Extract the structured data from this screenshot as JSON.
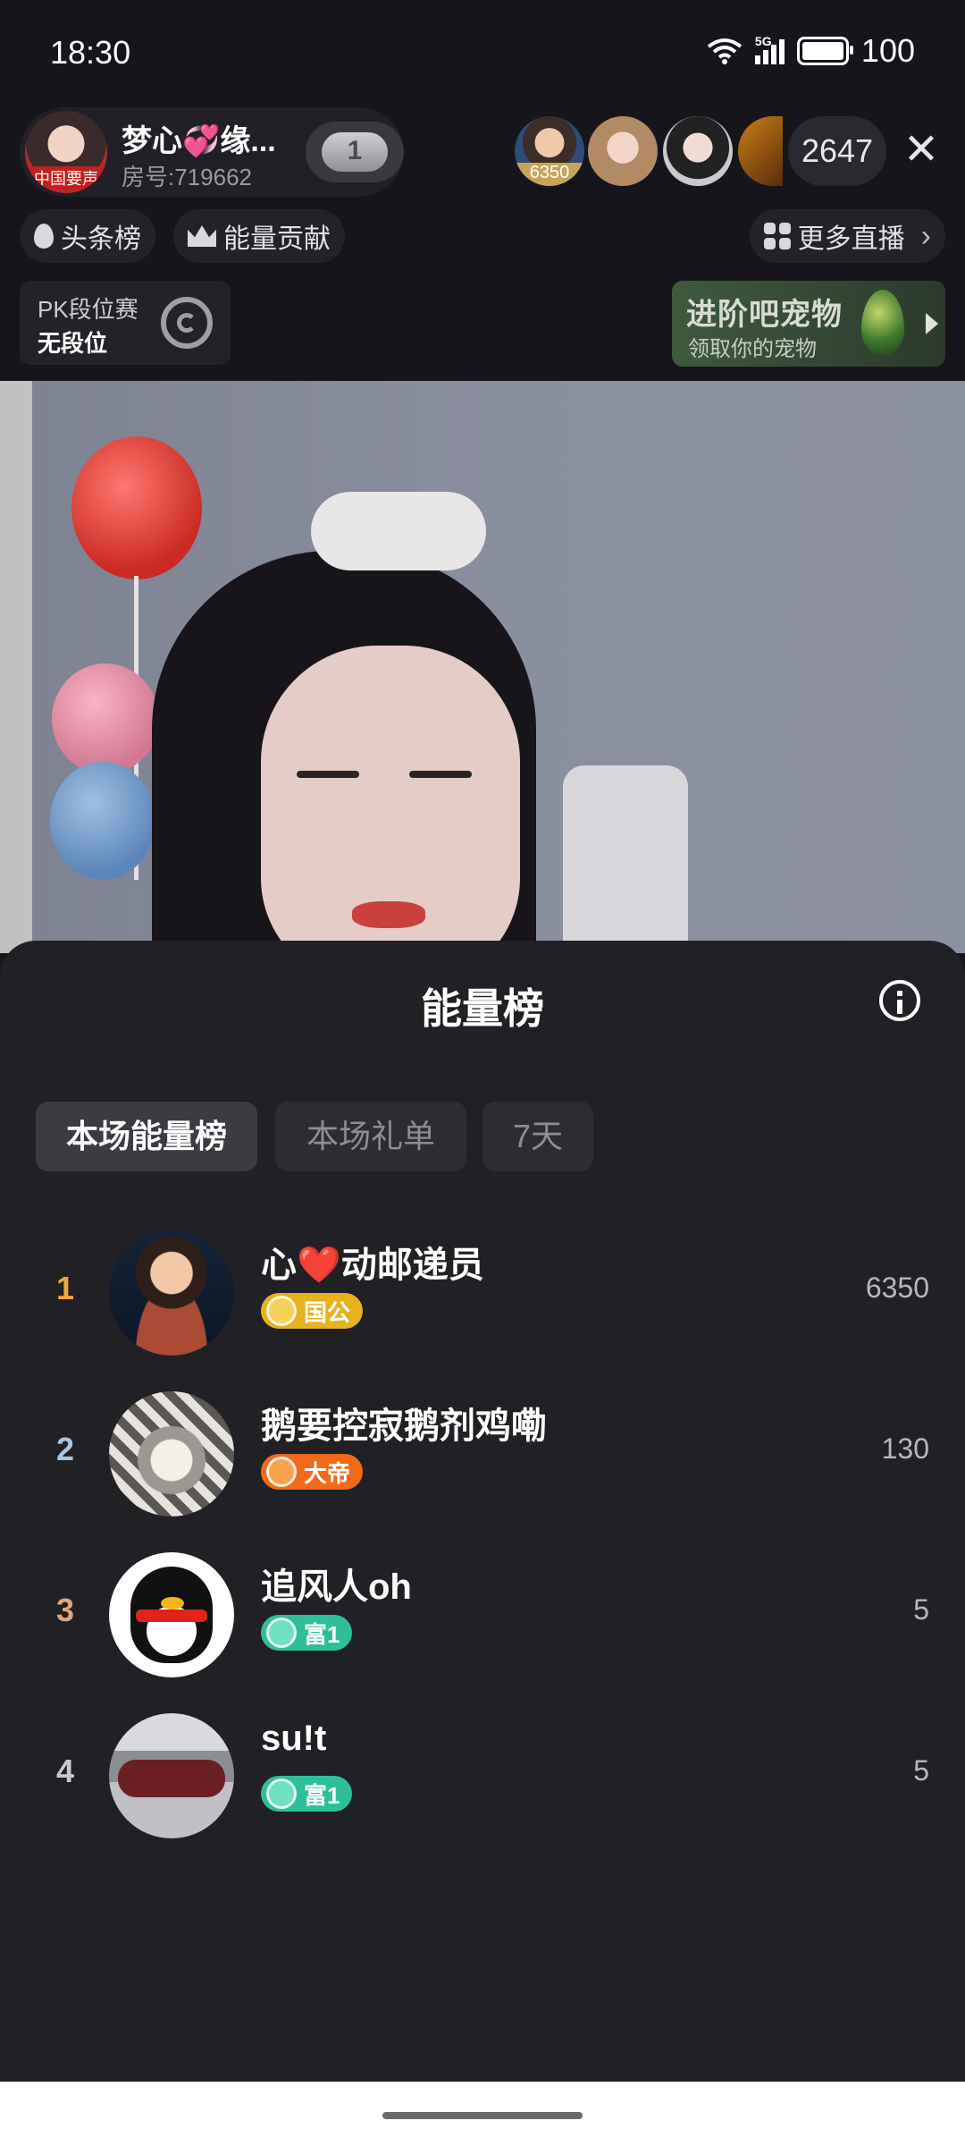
{
  "status": {
    "time": "18:30",
    "network": "5G",
    "battery": "100"
  },
  "header": {
    "host_name": "梦心💞缘...",
    "room_id": "房号:719662",
    "host_avatar_tag": "中国要声",
    "follow_badge": "1",
    "top_viewer_badge": "6350",
    "viewer_count": "2647",
    "close": "✕",
    "chips": {
      "headlines": "头条榜",
      "energy": "能量贡献",
      "more_live": "更多直播"
    },
    "pk": {
      "title": "PK段位赛",
      "rank": "无段位"
    },
    "pet": {
      "title": "进阶吧宠物",
      "subtitle": "领取你的宠物"
    }
  },
  "sheet": {
    "title": "能量榜",
    "tabs": [
      "本场能量榜",
      "本场礼单",
      "7天"
    ],
    "active_tab": 0,
    "rows": [
      {
        "rank": "1",
        "name": "心❤️动邮递员",
        "badge": "国公",
        "score": "6350",
        "rank_color": "#f0a93a",
        "badge_color": "#e7b21e"
      },
      {
        "rank": "2",
        "name": "鹅要控寂鹅剂鸡嘞",
        "badge": "大帝",
        "score": "130",
        "rank_color": "#a9c5e0",
        "badge_color": "#f06a1a"
      },
      {
        "rank": "3",
        "name": "追风人oh",
        "badge": "富1",
        "score": "5",
        "rank_color": "#e0a47c",
        "badge_color": "#2dbf9a"
      },
      {
        "rank": "4",
        "name": "su!t",
        "badge": "富1",
        "score": "5",
        "rank_color": "#c9c8ce",
        "badge_color": "#2dbf9a"
      }
    ]
  }
}
